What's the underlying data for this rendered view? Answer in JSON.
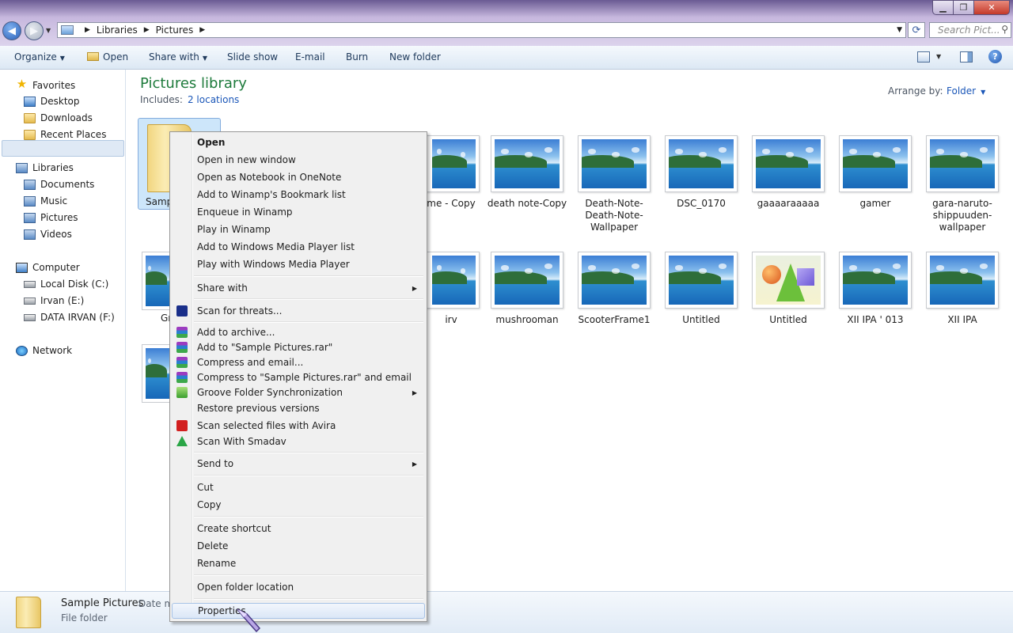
{
  "address": {
    "crumbs": [
      "Libraries",
      "Pictures"
    ]
  },
  "search": {
    "placeholder": "Search Pict..."
  },
  "toolbar": {
    "organize": "Organize",
    "open": "Open",
    "share_with": "Share with",
    "slide_show": "Slide show",
    "email": "E-mail",
    "burn": "Burn",
    "new_folder": "New folder"
  },
  "nav": {
    "favorites": "Favorites",
    "desktop": "Desktop",
    "downloads": "Downloads",
    "recent": "Recent Places",
    "libraries": "Libraries",
    "documents": "Documents",
    "music": "Music",
    "pictures": "Pictures",
    "videos": "Videos",
    "computer": "Computer",
    "local_disk": "Local Disk (C:)",
    "irvan": "Irvan (E:)",
    "data_irvan": "DATA IRVAN (F:)",
    "network": "Network"
  },
  "library": {
    "title": "Pictures library",
    "includes_label": "Includes:",
    "locations": "2 locations",
    "arrange_label": "Arrange by:",
    "arrange_value": "Folder"
  },
  "items_row1": [
    "Sample Pictures",
    "me - Copy",
    "death note-Copy",
    "Death-Note-Death-Note-Wallpaper",
    "DSC_0170",
    "gaaaaraaaaa",
    "gamer",
    "gara-naruto-shippuuden-wallpaper"
  ],
  "items_row2": [
    "Gr",
    "irv",
    "mushrooman",
    "ScooterFrame1",
    "Untitled",
    "Untitled",
    "XII IPA ' 013",
    "XII IPA"
  ],
  "sel_label_visible": "Samp",
  "context_menu": [
    "Open",
    "Open in new window",
    "Open as Notebook in OneNote",
    "Add to Winamp's Bookmark list",
    "Enqueue in Winamp",
    "Play in Winamp",
    "Add to Windows Media Player list",
    "Play with Windows Media Player",
    "Share with",
    "Scan for threats...",
    "Add to archive...",
    "Add to \"Sample Pictures.rar\"",
    "Compress and email...",
    "Compress to \"Sample Pictures.rar\" and email",
    "Groove Folder Synchronization",
    "Restore previous versions",
    "Scan selected files with Avira",
    "Scan With Smadav",
    "Send to",
    "Cut",
    "Copy",
    "Create shortcut",
    "Delete",
    "Rename",
    "Open folder location",
    "Properties"
  ],
  "details": {
    "name": "Sample Pictures",
    "type": "File folder",
    "date_label": "Date m"
  }
}
